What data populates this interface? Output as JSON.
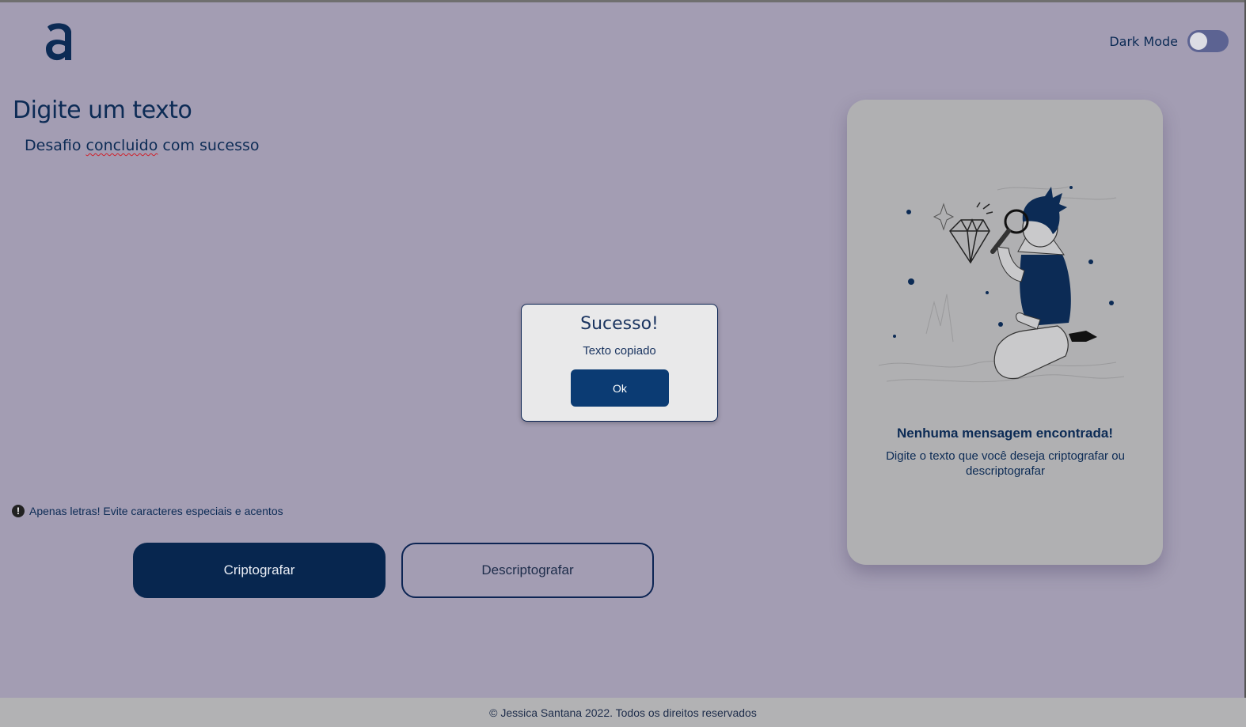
{
  "header": {
    "logo_icon": "a-letter-logo",
    "dark_mode_label": "Dark Mode",
    "dark_mode_on": false
  },
  "main": {
    "title": "Digite um texto",
    "textarea_before": "Desafio ",
    "textarea_misspelled": "concluido",
    "textarea_after": " com sucesso",
    "hint_icon": "exclamation-circle-icon",
    "hint_text": "Apenas letras! Evite caracteres especiais e acentos",
    "encrypt_label": "Criptografar",
    "decrypt_label": "Descriptografar"
  },
  "output_card": {
    "illustration": "person-with-magnifier-and-diamond",
    "title": "Nenhuma mensagem encontrada!",
    "text": "Digite o texto que você deseja criptografar ou descriptografar"
  },
  "modal": {
    "title": "Sucesso!",
    "text": "Texto copiado",
    "ok_label": "Ok"
  },
  "footer": {
    "text": "© Jessica Santana 2022. Todos os direitos reservados"
  },
  "colors": {
    "background": "#a39db3",
    "primary": "#07264f",
    "card": "#b0b0b2",
    "modal_button": "#0b3b73"
  }
}
